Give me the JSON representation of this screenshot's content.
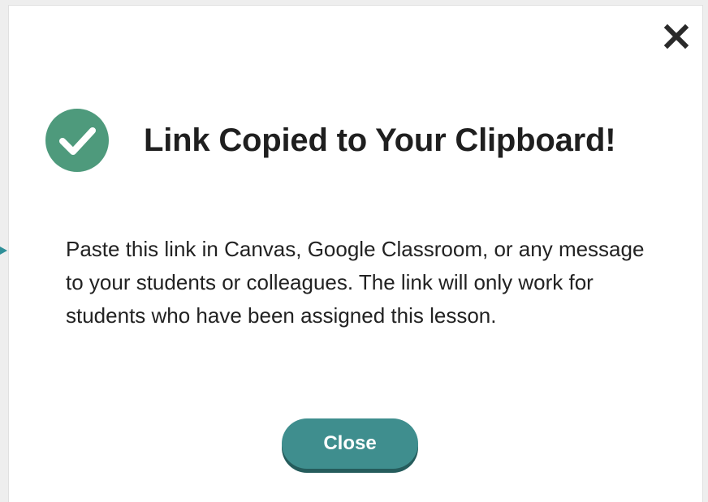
{
  "dialog": {
    "title": "Link Copied to Your Clipboard!",
    "message": "Paste this link in Canvas, Google Classroom, or any message to your students or colleagues. The link will only work for students who have been assigned this lesson.",
    "close_button_label": "Close",
    "icons": {
      "close": "close-icon",
      "success": "check-circle-icon"
    }
  },
  "colors": {
    "success_green": "#4e9a7c",
    "button_teal": "#3f8e8e",
    "button_shadow": "#255c5c",
    "title_text": "#1f1f1f"
  }
}
